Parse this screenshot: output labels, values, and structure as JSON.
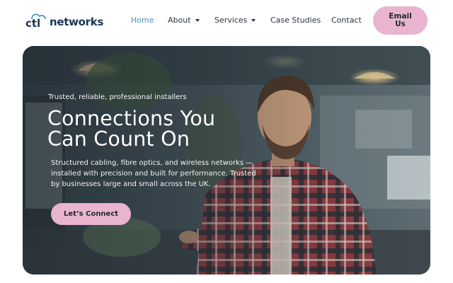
{
  "brand": {
    "logo_text": "networks",
    "accent": "#e9b4d0",
    "nav_active": "#4a90c2",
    "navy": "#1c3553"
  },
  "nav": {
    "home": "Home",
    "about": "About",
    "services": "Services",
    "case_studies": "Case Studies",
    "contact": "Contact",
    "active": "Home"
  },
  "header": {
    "email_button": "Email Us"
  },
  "hero": {
    "eyebrow": "Trusted, reliable, professional installers",
    "title": "Connections You Can Count On",
    "description": "Structured cabling, fibre optics, and wireless networks — installed with precision and built for performance. Trusted by businesses large and small across the UK.",
    "cta": "Let’s Connect"
  }
}
